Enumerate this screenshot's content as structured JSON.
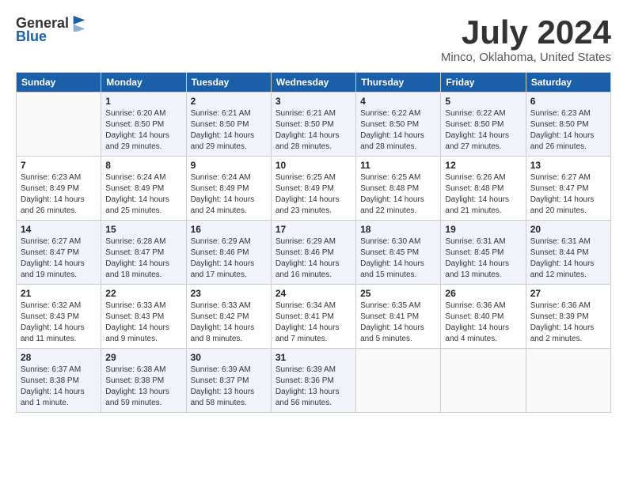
{
  "logo": {
    "general": "General",
    "blue": "Blue"
  },
  "title": "July 2024",
  "location": "Minco, Oklahoma, United States",
  "headers": [
    "Sunday",
    "Monday",
    "Tuesday",
    "Wednesday",
    "Thursday",
    "Friday",
    "Saturday"
  ],
  "weeks": [
    [
      {
        "day": "",
        "info": ""
      },
      {
        "day": "1",
        "info": "Sunrise: 6:20 AM\nSunset: 8:50 PM\nDaylight: 14 hours\nand 29 minutes."
      },
      {
        "day": "2",
        "info": "Sunrise: 6:21 AM\nSunset: 8:50 PM\nDaylight: 14 hours\nand 29 minutes."
      },
      {
        "day": "3",
        "info": "Sunrise: 6:21 AM\nSunset: 8:50 PM\nDaylight: 14 hours\nand 28 minutes."
      },
      {
        "day": "4",
        "info": "Sunrise: 6:22 AM\nSunset: 8:50 PM\nDaylight: 14 hours\nand 28 minutes."
      },
      {
        "day": "5",
        "info": "Sunrise: 6:22 AM\nSunset: 8:50 PM\nDaylight: 14 hours\nand 27 minutes."
      },
      {
        "day": "6",
        "info": "Sunrise: 6:23 AM\nSunset: 8:50 PM\nDaylight: 14 hours\nand 26 minutes."
      }
    ],
    [
      {
        "day": "7",
        "info": "Sunrise: 6:23 AM\nSunset: 8:49 PM\nDaylight: 14 hours\nand 26 minutes."
      },
      {
        "day": "8",
        "info": "Sunrise: 6:24 AM\nSunset: 8:49 PM\nDaylight: 14 hours\nand 25 minutes."
      },
      {
        "day": "9",
        "info": "Sunrise: 6:24 AM\nSunset: 8:49 PM\nDaylight: 14 hours\nand 24 minutes."
      },
      {
        "day": "10",
        "info": "Sunrise: 6:25 AM\nSunset: 8:49 PM\nDaylight: 14 hours\nand 23 minutes."
      },
      {
        "day": "11",
        "info": "Sunrise: 6:25 AM\nSunset: 8:48 PM\nDaylight: 14 hours\nand 22 minutes."
      },
      {
        "day": "12",
        "info": "Sunrise: 6:26 AM\nSunset: 8:48 PM\nDaylight: 14 hours\nand 21 minutes."
      },
      {
        "day": "13",
        "info": "Sunrise: 6:27 AM\nSunset: 8:47 PM\nDaylight: 14 hours\nand 20 minutes."
      }
    ],
    [
      {
        "day": "14",
        "info": "Sunrise: 6:27 AM\nSunset: 8:47 PM\nDaylight: 14 hours\nand 19 minutes."
      },
      {
        "day": "15",
        "info": "Sunrise: 6:28 AM\nSunset: 8:47 PM\nDaylight: 14 hours\nand 18 minutes."
      },
      {
        "day": "16",
        "info": "Sunrise: 6:29 AM\nSunset: 8:46 PM\nDaylight: 14 hours\nand 17 minutes."
      },
      {
        "day": "17",
        "info": "Sunrise: 6:29 AM\nSunset: 8:46 PM\nDaylight: 14 hours\nand 16 minutes."
      },
      {
        "day": "18",
        "info": "Sunrise: 6:30 AM\nSunset: 8:45 PM\nDaylight: 14 hours\nand 15 minutes."
      },
      {
        "day": "19",
        "info": "Sunrise: 6:31 AM\nSunset: 8:45 PM\nDaylight: 14 hours\nand 13 minutes."
      },
      {
        "day": "20",
        "info": "Sunrise: 6:31 AM\nSunset: 8:44 PM\nDaylight: 14 hours\nand 12 minutes."
      }
    ],
    [
      {
        "day": "21",
        "info": "Sunrise: 6:32 AM\nSunset: 8:43 PM\nDaylight: 14 hours\nand 11 minutes."
      },
      {
        "day": "22",
        "info": "Sunrise: 6:33 AM\nSunset: 8:43 PM\nDaylight: 14 hours\nand 9 minutes."
      },
      {
        "day": "23",
        "info": "Sunrise: 6:33 AM\nSunset: 8:42 PM\nDaylight: 14 hours\nand 8 minutes."
      },
      {
        "day": "24",
        "info": "Sunrise: 6:34 AM\nSunset: 8:41 PM\nDaylight: 14 hours\nand 7 minutes."
      },
      {
        "day": "25",
        "info": "Sunrise: 6:35 AM\nSunset: 8:41 PM\nDaylight: 14 hours\nand 5 minutes."
      },
      {
        "day": "26",
        "info": "Sunrise: 6:36 AM\nSunset: 8:40 PM\nDaylight: 14 hours\nand 4 minutes."
      },
      {
        "day": "27",
        "info": "Sunrise: 6:36 AM\nSunset: 8:39 PM\nDaylight: 14 hours\nand 2 minutes."
      }
    ],
    [
      {
        "day": "28",
        "info": "Sunrise: 6:37 AM\nSunset: 8:38 PM\nDaylight: 14 hours\nand 1 minute."
      },
      {
        "day": "29",
        "info": "Sunrise: 6:38 AM\nSunset: 8:38 PM\nDaylight: 13 hours\nand 59 minutes."
      },
      {
        "day": "30",
        "info": "Sunrise: 6:39 AM\nSunset: 8:37 PM\nDaylight: 13 hours\nand 58 minutes."
      },
      {
        "day": "31",
        "info": "Sunrise: 6:39 AM\nSunset: 8:36 PM\nDaylight: 13 hours\nand 56 minutes."
      },
      {
        "day": "",
        "info": ""
      },
      {
        "day": "",
        "info": ""
      },
      {
        "day": "",
        "info": ""
      }
    ]
  ]
}
